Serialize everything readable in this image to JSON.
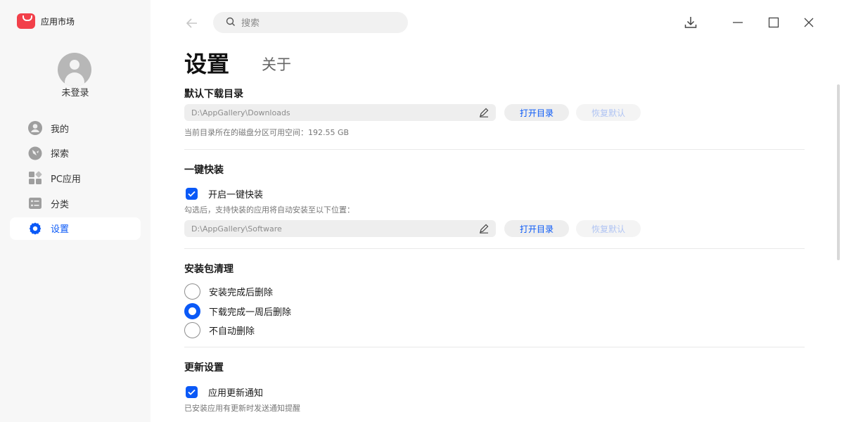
{
  "app": {
    "name": "应用市场",
    "brand_color": "#f2404a"
  },
  "user": {
    "status": "未登录"
  },
  "nav": {
    "items": [
      {
        "label": "我的",
        "icon": "user-icon"
      },
      {
        "label": "探索",
        "icon": "explore-icon"
      },
      {
        "label": "PC应用",
        "icon": "apps-grid-icon"
      },
      {
        "label": "分类",
        "icon": "category-icon"
      },
      {
        "label": "设置",
        "icon": "settings-gear-icon",
        "active": true
      }
    ]
  },
  "search": {
    "placeholder": "搜索"
  },
  "window": {
    "buttons": [
      "download-icon",
      "minimize-icon",
      "maximize-icon",
      "close-icon"
    ]
  },
  "page": {
    "title": "设置",
    "about_tab": "关于"
  },
  "download_dir": {
    "title": "默认下载目录",
    "path": "D:\\AppGallery\\Downloads",
    "open_label": "打开目录",
    "reset_label": "恢复默认",
    "space_hint": "当前目录所在的磁盘分区可用空间：192.55 GB"
  },
  "quick_install": {
    "title": "一键快装",
    "checkbox_label": "开启一键快装",
    "checked": true,
    "hint": "勾选后，支持快装的应用将自动安装至以下位置：",
    "path": "D:\\AppGallery\\Software",
    "open_label": "打开目录",
    "reset_label": "恢复默认"
  },
  "package_cleanup": {
    "title": "安装包清理",
    "options": [
      {
        "label": "安装完成后删除",
        "selected": false
      },
      {
        "label": "下载完成一周后删除",
        "selected": true
      },
      {
        "label": "不自动删除",
        "selected": false
      }
    ]
  },
  "update_settings": {
    "title": "更新设置",
    "checkbox_label": "应用更新通知",
    "checked": true,
    "hint": "已安装应用有更新时发送通知提醒"
  },
  "colors": {
    "accent": "#0a59f7",
    "sidebar_bg": "#f7f7f7"
  }
}
